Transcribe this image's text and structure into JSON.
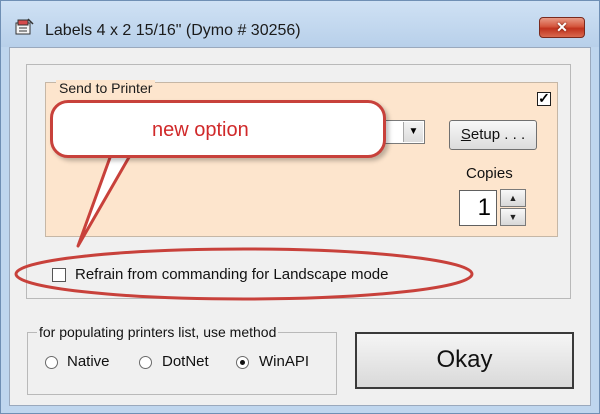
{
  "window": {
    "title": "Labels 4 x 2 15/16\" (Dymo # 30256)",
    "close_label": "✕"
  },
  "send_to_printer": {
    "legend": "Send to Printer",
    "enabled_checkbox": "checked",
    "check_glyph": "✓",
    "printer_dropdown_arrow": "▼",
    "setup_label": "Setup . . .",
    "setup_mnemonic": "S",
    "setup_rest": "etup . . .",
    "copies_label": "Copies",
    "copies_value": "1",
    "spin_up": "▲",
    "spin_down": "▼"
  },
  "annotation": {
    "callout_text": "new option",
    "color": "#c8413b"
  },
  "landscape_option": {
    "label": "Refrain from commanding for Landscape mode",
    "checked": false
  },
  "printer_list_method": {
    "legend": "for populating printers list, use method",
    "options": [
      {
        "label": "Native",
        "selected": false
      },
      {
        "label": "DotNet",
        "selected": false
      },
      {
        "label": "WinAPI",
        "selected": true
      }
    ]
  },
  "okay_button": {
    "label": "Okay"
  },
  "colors": {
    "frame": "#bfd6ee",
    "panel": "#fde5cd",
    "close_button": "#c0321d",
    "annotation_text": "#d0292a"
  }
}
